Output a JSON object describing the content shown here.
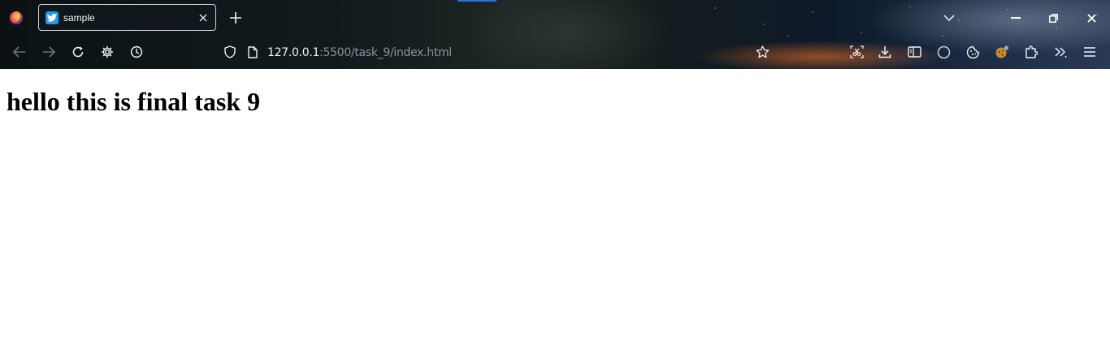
{
  "tabs": [
    {
      "title": "sample",
      "icon": "twitter-bird-icon",
      "active": true
    }
  ],
  "urlbar": {
    "host": "127.0.0.1",
    "path": ":5500/task_9/index.html"
  },
  "toolbar": {
    "nav_icons": [
      "back-arrow-icon",
      "forward-arrow-icon",
      "reload-icon",
      "settings-gear-icon",
      "history-clock-icon"
    ],
    "right_icons": [
      "bookmark-star-icon",
      "screenshot-icon",
      "download-icon",
      "reader-view-icon",
      "circle-icon",
      "cookie-icon",
      "cookie-extension-icon",
      "extensions-puzzle-icon",
      "overflow-chevrons-icon",
      "hamburger-menu-icon"
    ]
  },
  "window_controls": [
    "list-all-tabs-icon",
    "minimize-icon",
    "restore-icon",
    "close-window-icon"
  ],
  "page": {
    "heading": "hello this is final task 9"
  },
  "colors": {
    "tab_border": "#c9d3e0",
    "favicon_bg": "#1d9bf0",
    "url_host": "#f2f4f6",
    "url_path": "#8a9299",
    "page_bg": "#ffffff",
    "heading": "#000000"
  }
}
